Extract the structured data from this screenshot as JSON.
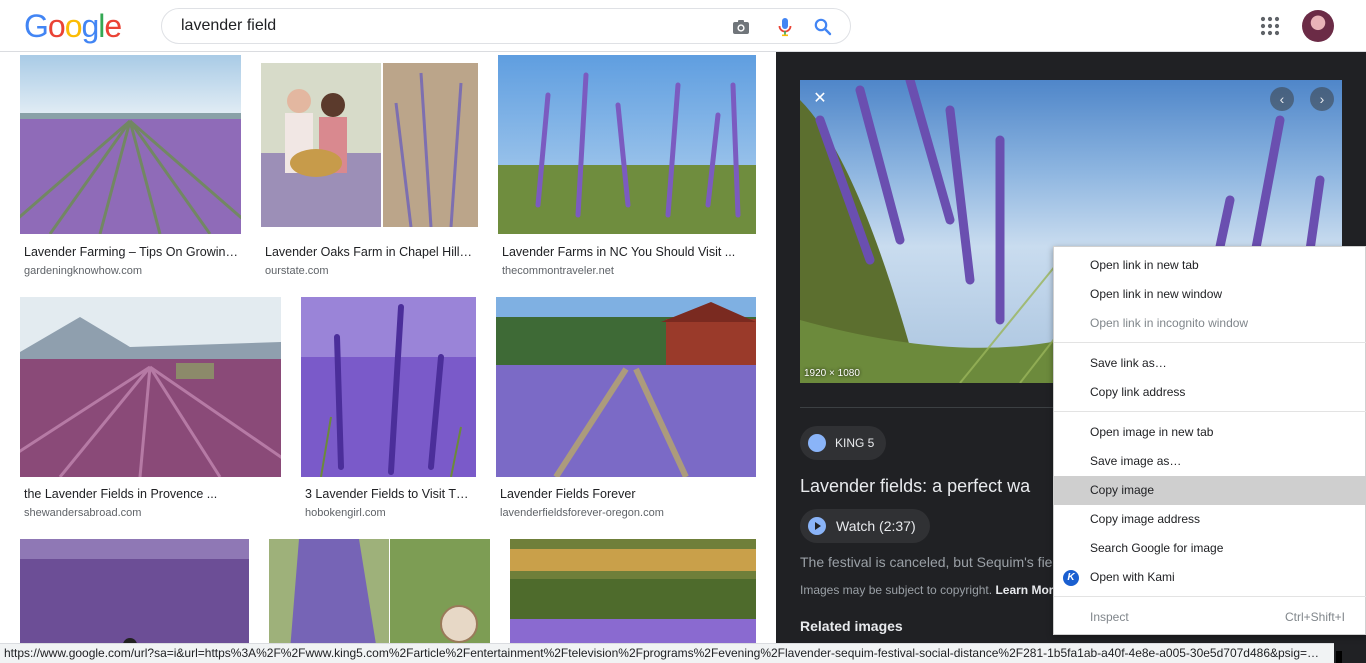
{
  "header": {
    "logo": [
      "G",
      "o",
      "o",
      "g",
      "l",
      "e"
    ],
    "logo_colors": [
      "#4285F4",
      "#EA4335",
      "#FBBC05",
      "#4285F4",
      "#34A853",
      "#EA4335"
    ],
    "search_value": "lavender field"
  },
  "results": [
    {
      "title": "Lavender Farming – Tips On Growing…",
      "source": "gardeningknowhow.com"
    },
    {
      "title": "Lavender Oaks Farm in Chapel Hill | …",
      "source": "ourstate.com"
    },
    {
      "title": "Lavender Farms in NC You Should Visit ...",
      "source": "thecommontraveler.net"
    },
    {
      "title": "the Lavender Fields in Provence ...",
      "source": "shewandersabroad.com"
    },
    {
      "title": "3 Lavender Fields to Visit Thi…",
      "source": "hobokengirl.com"
    },
    {
      "title": "Lavender Fields Forever",
      "source": "lavenderfieldsforever-oregon.com"
    },
    {
      "title": "",
      "source": ""
    },
    {
      "title": "",
      "source": ""
    },
    {
      "title": "",
      "source": ""
    }
  ],
  "panel": {
    "dimensions": "1920 × 1080",
    "source": "KING 5",
    "title": "Lavender fields: a perfect wa",
    "watch": "Watch (2:37)",
    "snippet": "The festival is canceled, but Sequim's fiel",
    "copyright": "Images may be subject to copyright.",
    "learn_more": "Learn Mor",
    "related": "Related images"
  },
  "context_menu": {
    "items": [
      {
        "label": "Open link in new tab"
      },
      {
        "label": "Open link in new window"
      },
      {
        "label": "Open link in incognito window"
      },
      {
        "label": "Save link as…"
      },
      {
        "label": "Copy link address"
      },
      {
        "label": "Open image in new tab"
      },
      {
        "label": "Save image as…"
      },
      {
        "label": "Copy image"
      },
      {
        "label": "Copy image address"
      },
      {
        "label": "Search Google for image"
      },
      {
        "label": "Open with Kami"
      },
      {
        "label": "Inspect",
        "shortcut": "Ctrl+Shift+I"
      }
    ],
    "kami_letter": "K",
    "highlighted": "Copy image"
  },
  "statusbar": {
    "url": "https://www.google.com/url?sa=i&url=https%3A%2F%2Fwww.king5.com%2Farticle%2Fentertainment%2Ftelevision%2Fprograms%2Fevening%2Flavender-sequim-festival-social-distance%2F281-1b5fa1ab-a40f-4e8e-a005-30e5d707d486&psig=…"
  }
}
